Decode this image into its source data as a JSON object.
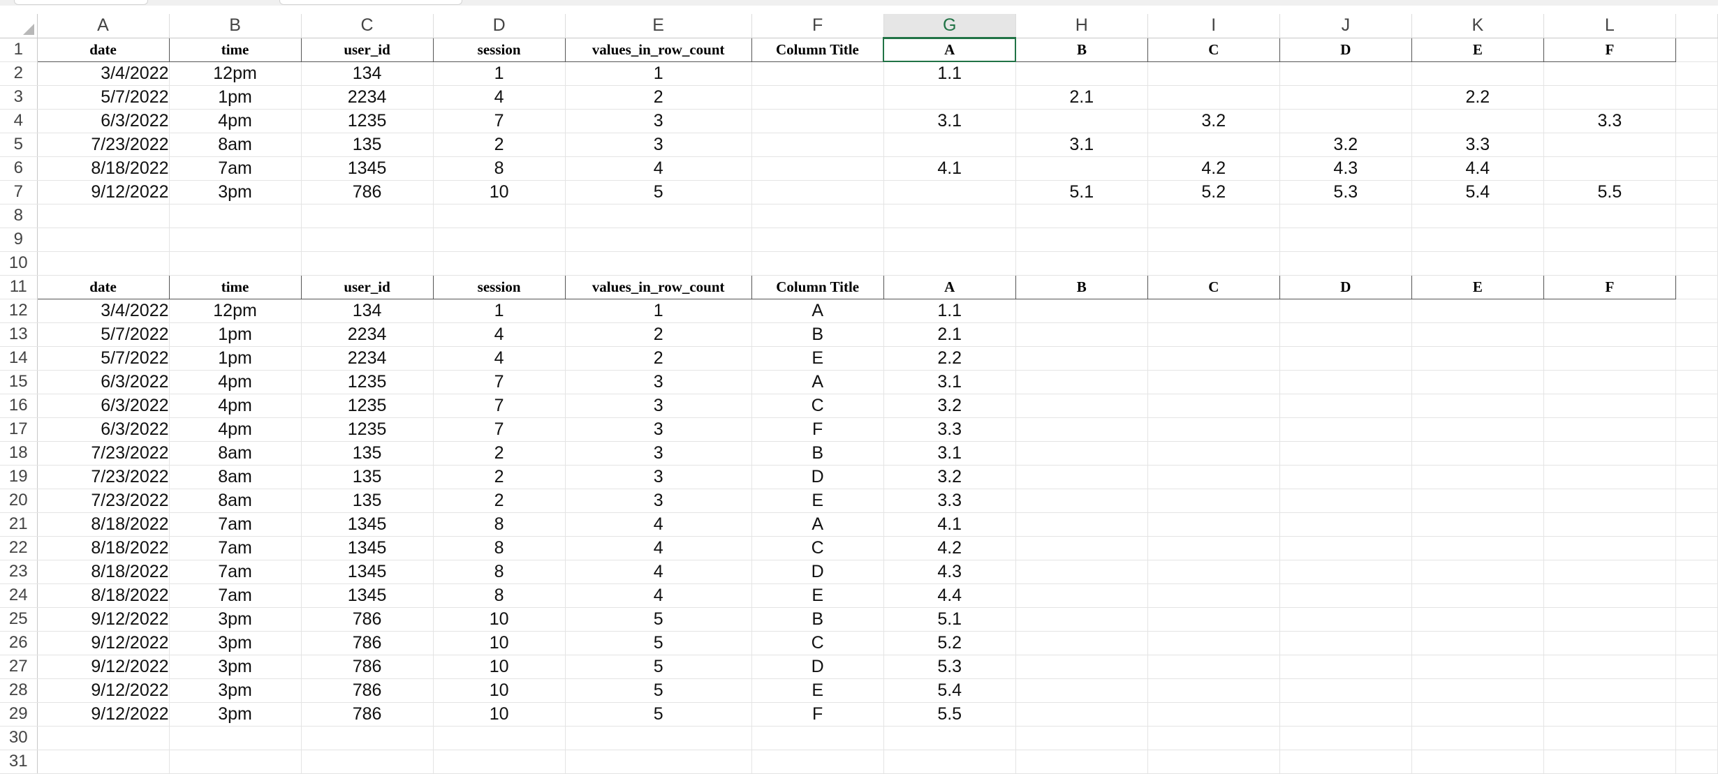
{
  "columns": [
    "A",
    "B",
    "C",
    "D",
    "E",
    "F",
    "G",
    "H",
    "I",
    "J",
    "K",
    "L"
  ],
  "selected_column": "G",
  "top_header": [
    "date",
    "time",
    "user_id",
    "session",
    "values_in_row_count",
    "Column Title",
    "A",
    "B",
    "C",
    "D",
    "E",
    "F"
  ],
  "top_rows": [
    [
      "3/4/2022",
      "12pm",
      "134",
      "1",
      "1",
      "",
      "1.1",
      "",
      "",
      "",
      "",
      ""
    ],
    [
      "5/7/2022",
      "1pm",
      "2234",
      "4",
      "2",
      "",
      "",
      "2.1",
      "",
      "",
      "2.2",
      ""
    ],
    [
      "6/3/2022",
      "4pm",
      "1235",
      "7",
      "3",
      "",
      "3.1",
      "",
      "3.2",
      "",
      "",
      "3.3"
    ],
    [
      "7/23/2022",
      "8am",
      "135",
      "2",
      "3",
      "",
      "",
      "3.1",
      "",
      "3.2",
      "3.3",
      ""
    ],
    [
      "8/18/2022",
      "7am",
      "1345",
      "8",
      "4",
      "",
      "4.1",
      "",
      "4.2",
      "4.3",
      "4.4",
      ""
    ],
    [
      "9/12/2022",
      "3pm",
      "786",
      "10",
      "5",
      "",
      "",
      "5.1",
      "5.2",
      "5.3",
      "5.4",
      "5.5"
    ]
  ],
  "bottom_header": [
    "date",
    "time",
    "user_id",
    "session",
    "values_in_row_count",
    "Column Title",
    "A",
    "B",
    "C",
    "D",
    "E",
    "F"
  ],
  "bottom_rows": [
    [
      "3/4/2022",
      "12pm",
      "134",
      "1",
      "1",
      "A",
      "1.1"
    ],
    [
      "5/7/2022",
      "1pm",
      "2234",
      "4",
      "2",
      "B",
      "2.1"
    ],
    [
      "5/7/2022",
      "1pm",
      "2234",
      "4",
      "2",
      "E",
      "2.2"
    ],
    [
      "6/3/2022",
      "4pm",
      "1235",
      "7",
      "3",
      "A",
      "3.1"
    ],
    [
      "6/3/2022",
      "4pm",
      "1235",
      "7",
      "3",
      "C",
      "3.2"
    ],
    [
      "6/3/2022",
      "4pm",
      "1235",
      "7",
      "3",
      "F",
      "3.3"
    ],
    [
      "7/23/2022",
      "8am",
      "135",
      "2",
      "3",
      "B",
      "3.1"
    ],
    [
      "7/23/2022",
      "8am",
      "135",
      "2",
      "3",
      "D",
      "3.2"
    ],
    [
      "7/23/2022",
      "8am",
      "135",
      "2",
      "3",
      "E",
      "3.3"
    ],
    [
      "8/18/2022",
      "7am",
      "1345",
      "8",
      "4",
      "A",
      "4.1"
    ],
    [
      "8/18/2022",
      "7am",
      "1345",
      "8",
      "4",
      "C",
      "4.2"
    ],
    [
      "8/18/2022",
      "7am",
      "1345",
      "8",
      "4",
      "D",
      "4.3"
    ],
    [
      "8/18/2022",
      "7am",
      "1345",
      "8",
      "4",
      "E",
      "4.4"
    ],
    [
      "9/12/2022",
      "3pm",
      "786",
      "10",
      "5",
      "B",
      "5.1"
    ],
    [
      "9/12/2022",
      "3pm",
      "786",
      "10",
      "5",
      "C",
      "5.2"
    ],
    [
      "9/12/2022",
      "3pm",
      "786",
      "10",
      "5",
      "D",
      "5.3"
    ],
    [
      "9/12/2022",
      "3pm",
      "786",
      "10",
      "5",
      "E",
      "5.4"
    ],
    [
      "9/12/2022",
      "3pm",
      "786",
      "10",
      "5",
      "F",
      "5.5"
    ]
  ],
  "row_numbers": [
    "1",
    "2",
    "3",
    "4",
    "5",
    "6",
    "7",
    "8",
    "9",
    "10",
    "11",
    "12",
    "13",
    "14",
    "15",
    "16",
    "17",
    "18",
    "19",
    "20",
    "21",
    "22",
    "23",
    "24",
    "25",
    "26",
    "27",
    "28",
    "29",
    "30",
    "31"
  ]
}
